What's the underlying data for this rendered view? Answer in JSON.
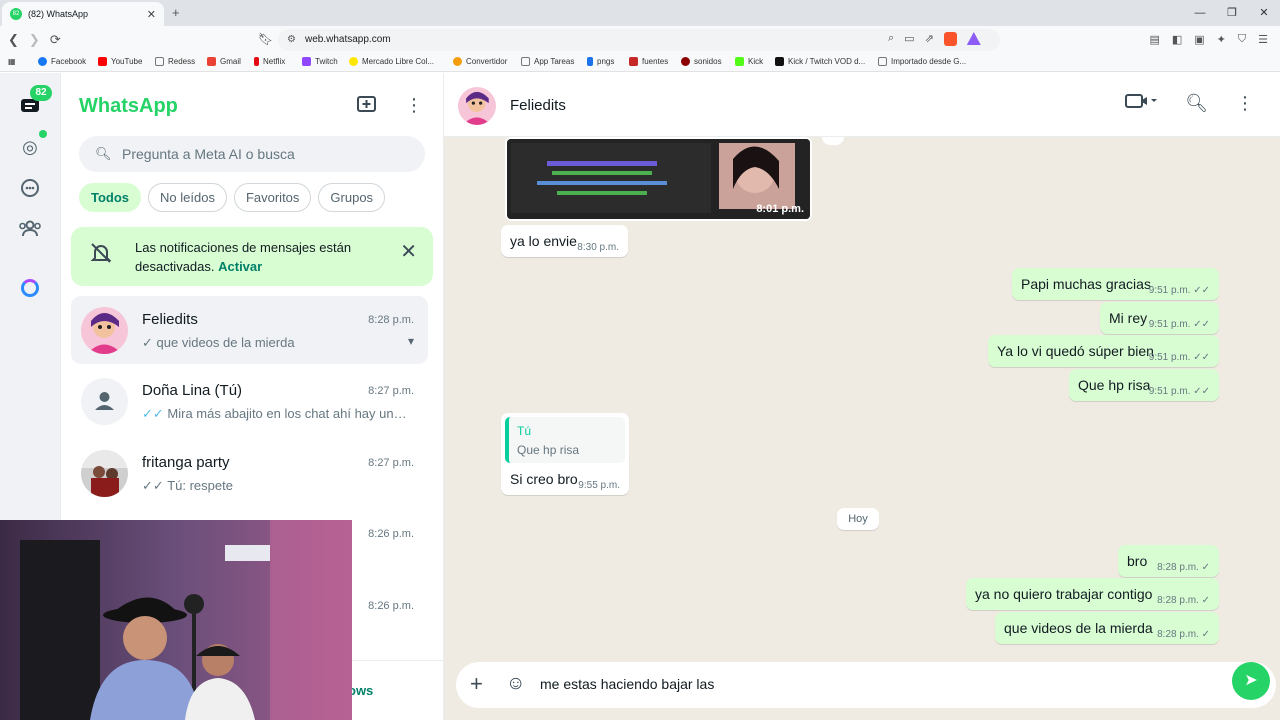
{
  "browser": {
    "tab_title": "(82) WhatsApp",
    "tab_close": "✕",
    "new_tab": "+",
    "url": "web.whatsapp.com",
    "window_controls": [
      "—",
      "❐",
      "✕"
    ],
    "bookmarks": [
      {
        "label": "Facebook",
        "color": "#1877f2"
      },
      {
        "label": "YouTube",
        "color": "#ff0000"
      },
      {
        "label": "Redess",
        "color": "#777777"
      },
      {
        "label": "Gmail",
        "color": "#ea4335"
      },
      {
        "label": "Netflix",
        "color": "#e50914"
      },
      {
        "label": "Twitch",
        "color": "#9146ff"
      },
      {
        "label": "Mercado Libre Col...",
        "color": "#ffe600"
      },
      {
        "label": "Convertidor",
        "color": "#f59e0b"
      },
      {
        "label": "App Tareas",
        "color": "#777777"
      },
      {
        "label": "pngs",
        "color": "#1a73e8"
      },
      {
        "label": "fuentes",
        "color": "#c62828"
      },
      {
        "label": "sonidos",
        "color": "#8b0000"
      },
      {
        "label": "Kick",
        "color": "#53fc18"
      },
      {
        "label": "Kick / Twitch VOD d...",
        "color": "#111111"
      },
      {
        "label": "Importado desde G...",
        "color": "#777777"
      }
    ]
  },
  "rail": {
    "badge": "82"
  },
  "sidebar": {
    "brand": "WhatsApp",
    "search_placeholder": "Pregunta a Meta AI o busca",
    "filters": [
      "Todos",
      "No leídos",
      "Favoritos",
      "Grupos"
    ],
    "notification": {
      "text": "Las notificaciones de mensajes están desactivadas.",
      "action": "Activar"
    },
    "chats": [
      {
        "name": "Feliedits",
        "time": "8:28 p.m.",
        "tick": "✓",
        "preview": "que videos de la mierda"
      },
      {
        "name": "Doña Lina (Tú)",
        "time": "8:27 p.m.",
        "tick": "✓✓",
        "preview": "Mira más abajito en los chat ahí hay una ..."
      },
      {
        "name": "fritanga party",
        "time": "8:27 p.m.",
        "tick": "✓✓",
        "preview": "Tú: respete"
      },
      {
        "name": "",
        "time": "8:26 p.m.",
        "tick": "",
        "preview": ""
      },
      {
        "name": "",
        "time": "8:26 p.m.",
        "tick": "",
        "preview": ""
      }
    ],
    "footer_fragment": "ows"
  },
  "conversation": {
    "contact": "Feliedits",
    "video_time": "8:01 p.m.",
    "messages": [
      {
        "dir": "in",
        "text": "ya lo envie",
        "time": "8:30 p.m.",
        "status": ""
      },
      {
        "dir": "out",
        "text": "Papi muchas gracias",
        "time": "9:51 p.m.",
        "status": "✓✓"
      },
      {
        "dir": "out",
        "text": "Mi rey",
        "time": "9:51 p.m.",
        "status": "✓✓"
      },
      {
        "dir": "out",
        "text": "Ya lo vi quedó súper bien",
        "time": "9:51 p.m.",
        "status": "✓✓"
      },
      {
        "dir": "out",
        "text": "Que hp risa",
        "time": "9:51 p.m.",
        "status": "✓✓"
      },
      {
        "dir": "in",
        "text": "Si creo bro",
        "time": "9:55 p.m.",
        "status": "",
        "quote_author": "Tú",
        "quote_text": "Que hp risa"
      },
      {
        "dir": "out",
        "text": "bro",
        "time": "8:28 p.m.",
        "status": "✓"
      },
      {
        "dir": "out",
        "text": "ya no quiero trabajar contigo",
        "time": "8:28 p.m.",
        "status": "✓"
      },
      {
        "dir": "out",
        "text": "que videos de la mierda",
        "time": "8:28 p.m.",
        "status": "✓"
      }
    ],
    "day_divider": "Hoy",
    "composer_text": "me estas haciendo bajar las"
  },
  "colors": {
    "accent": "#25d366",
    "outgoing_bubble": "#d9fdd3",
    "chat_bg": "#efeae2",
    "read_tick": "#53bdeb"
  }
}
